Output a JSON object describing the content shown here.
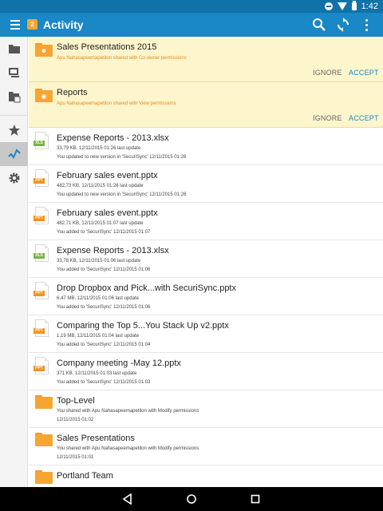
{
  "status_bar": {
    "time": "1:42",
    "icons": [
      "do-not-disturb-icon",
      "wifi-icon",
      "battery-icon"
    ]
  },
  "toolbar": {
    "badge_count": "2",
    "title": "Activity",
    "actions": [
      "search-icon",
      "sync-icon",
      "more-vert-icon"
    ]
  },
  "rail": {
    "items": [
      "folder-icon",
      "computer-icon",
      "shared-folder-icon",
      "star-icon",
      "activity-icon",
      "settings-icon"
    ],
    "active": "activity-icon"
  },
  "share_cards": [
    {
      "title": "Sales Presentations 2015",
      "subtitle": "Apu Nahasapeemapetilon shared with Co-owner permissions",
      "icon": "shared-folder-icon",
      "ignore_label": "IGNORE",
      "accept_label": "ACCEPT"
    },
    {
      "title": "Reports",
      "subtitle": "Apu Nahasapeemapetilon shared with View permissions",
      "icon": "view-folder-icon",
      "ignore_label": "IGNORE",
      "accept_label": "ACCEPT"
    }
  ],
  "activity_items": [
    {
      "type": "XLS",
      "title": "Expense Reports - 2013.xlsx",
      "line1": "33,79 KB, 12/11/2015 01:26 last update",
      "line2": "You updated to new version in 'SecuriSync' 12/11/2015 01:26"
    },
    {
      "type": "PPT",
      "title": "February sales event.pptx",
      "line1": "482,73 KB, 12/11/2015 01:26 last update",
      "line2": "You updated to new version in 'SecuriSync' 12/11/2015 01:26"
    },
    {
      "type": "PPT",
      "title": "February sales event.pptx",
      "line1": "482,71 KB, 12/11/2015 01:07 last update",
      "line2": "You added to 'SecuriSync' 12/11/2015 01:07"
    },
    {
      "type": "XLS",
      "title": "Expense Reports - 2013.xlsx",
      "line1": "33,78 KB, 12/11/2015 01:06 last update",
      "line2": "You added to 'SecuriSync' 12/11/2015 01:06"
    },
    {
      "type": "PPT",
      "title": "Drop Dropbox and Pick...with SecuriSync.pptx",
      "line1": "6,47 MB, 12/11/2015 01:06 last update",
      "line2": "You added to 'SecuriSync' 12/11/2015 01:06"
    },
    {
      "type": "PPT",
      "title": "Comparing the Top 5...You Stack Up v2.pptx",
      "line1": "1,19 MB, 12/11/2015 01:04 last update",
      "line2": "You added to 'SecuriSync' 12/11/2015 01:04"
    },
    {
      "type": "PPT",
      "title": "Company meeting -May 12.pptx",
      "line1": "371 KB, 12/11/2015 01:03 last update",
      "line2": "You added to 'SecuriSync' 12/11/2015 01:03"
    },
    {
      "type": "FOLDER",
      "title": "Top-Level",
      "line1": "You shared with Apu Nahasapeemapetilon with Modify permissions",
      "line2": "12/11/2015 01:02"
    },
    {
      "type": "FOLDER",
      "title": "Sales Presentations",
      "line1": "You shared with Apu Nahasapeemapetilon with Modify permissions",
      "line2": "12/11/2015 01:01"
    },
    {
      "type": "FOLDER",
      "title": "Portland Team",
      "line1": "",
      "line2": ""
    }
  ],
  "nav_bar": [
    "back-icon",
    "home-icon",
    "recents-icon"
  ]
}
